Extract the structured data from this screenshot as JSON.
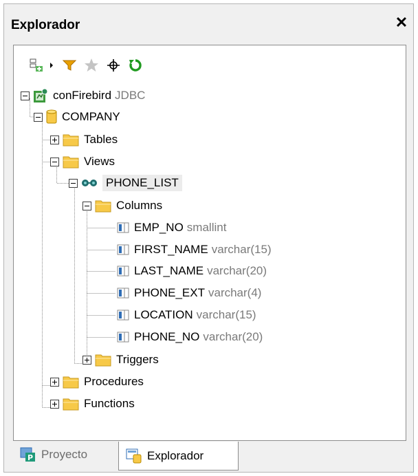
{
  "window": {
    "title": "Explorador",
    "close_glyph": "✕"
  },
  "toolbar": {
    "icons": [
      "add-connection-icon",
      "dropdown-arrow-icon",
      "filter-icon",
      "favorites-icon",
      "locate-icon",
      "refresh-icon"
    ]
  },
  "tree": {
    "connection": {
      "name": "conFirebird",
      "type": "JDBC"
    },
    "database": {
      "name": "COMPANY"
    },
    "tables": {
      "label": "Tables"
    },
    "views": {
      "label": "Views"
    },
    "view": {
      "name": "PHONE_LIST"
    },
    "columns": {
      "label": "Columns"
    },
    "column_items": [
      {
        "name": "EMP_NO",
        "type": "smallint"
      },
      {
        "name": "FIRST_NAME",
        "type": "varchar(15)"
      },
      {
        "name": "LAST_NAME",
        "type": "varchar(20)"
      },
      {
        "name": "PHONE_EXT",
        "type": "varchar(4)"
      },
      {
        "name": "LOCATION",
        "type": "varchar(15)"
      },
      {
        "name": "PHONE_NO",
        "type": "varchar(20)"
      }
    ],
    "triggers": {
      "label": "Triggers"
    },
    "procedures": {
      "label": "Procedures"
    },
    "functions": {
      "label": "Functions"
    }
  },
  "tabs": [
    {
      "label": "Proyecto",
      "active": false
    },
    {
      "label": "Explorador",
      "active": true
    }
  ],
  "colors": {
    "folder": "#f7c948",
    "refresh": "#1f9a1f",
    "filter": "#e8a000",
    "selection": "#ececec"
  }
}
